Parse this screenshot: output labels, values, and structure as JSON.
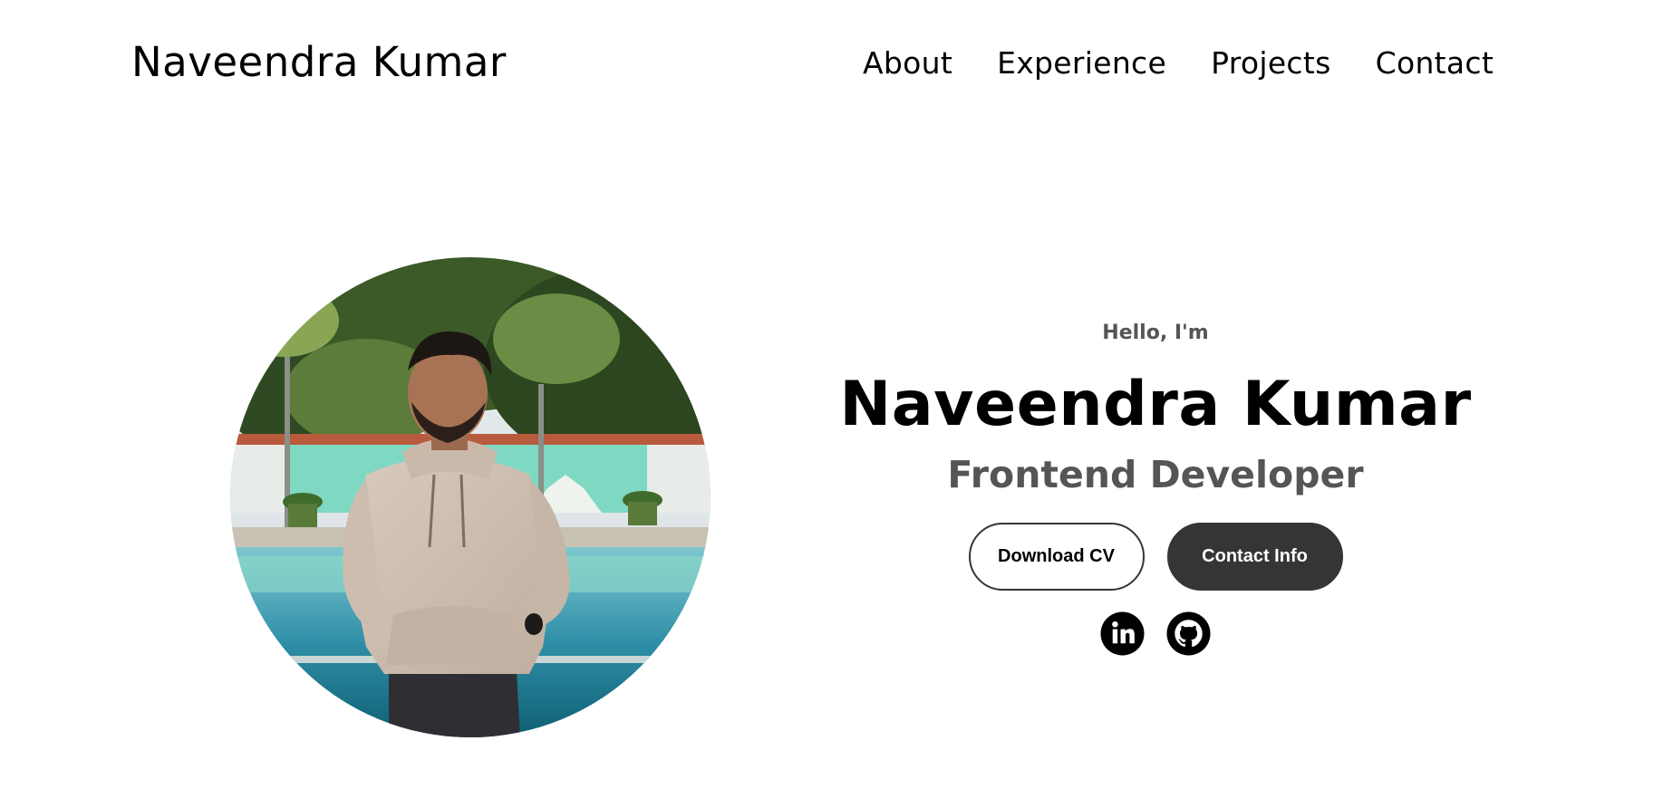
{
  "header": {
    "logo": "Naveendra Kumar",
    "nav": [
      {
        "label": "About"
      },
      {
        "label": "Experience"
      },
      {
        "label": "Projects"
      },
      {
        "label": "Contact"
      }
    ]
  },
  "hero": {
    "greeting": "Hello, I'm",
    "name": "Naveendra Kumar",
    "role": "Frontend Developer",
    "buttons": {
      "download_cv": "Download CV",
      "contact_info": "Contact Info"
    },
    "socials": [
      {
        "icon": "linkedin-icon"
      },
      {
        "icon": "github-icon"
      }
    ]
  },
  "colors": {
    "text": "#000000",
    "muted": "#555555",
    "button_dark": "#353535",
    "background": "#ffffff"
  }
}
